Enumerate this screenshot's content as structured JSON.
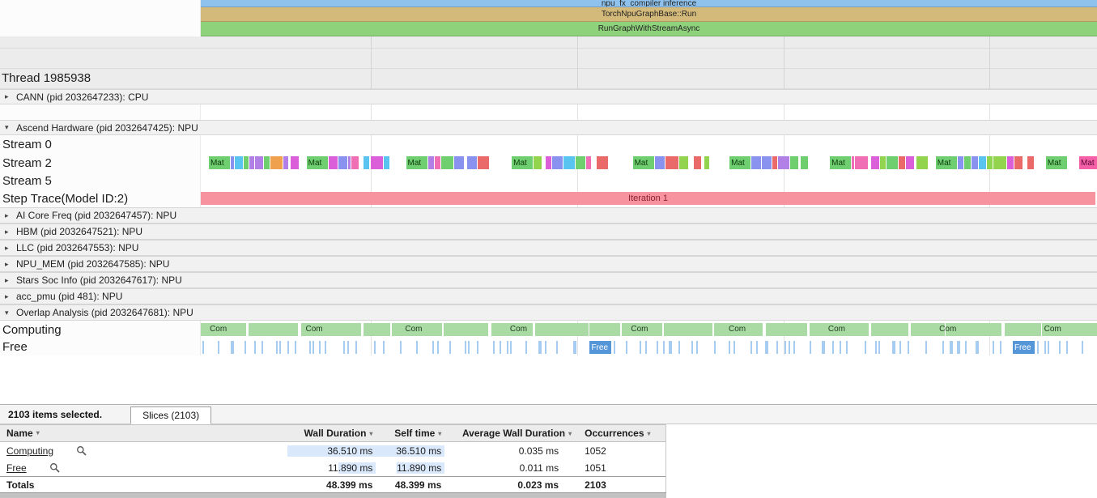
{
  "layout": {
    "grid_pct": [
      19,
      42,
      65,
      88
    ]
  },
  "top_bars": [
    {
      "label": "npu_fx_compiler inference",
      "color": "#8fc3ee"
    },
    {
      "label": "TorchNpuGraphBase::Run",
      "color": "#d4ba7a"
    },
    {
      "label": "RunGraphWithStreamAsync",
      "color": "#8fd27c"
    }
  ],
  "thread_label": "Thread 1985938",
  "headers": {
    "cann": {
      "arrow": "▸",
      "label": "CANN (pid 2032647233): CPU"
    },
    "ascend": {
      "arrow": "▾",
      "label": "Ascend Hardware (pid 2032647425): NPU"
    },
    "collapsed": [
      {
        "arrow": "▸",
        "label": "AI Core Freq (pid 2032647457): NPU"
      },
      {
        "arrow": "▸",
        "label": "HBM (pid 2032647521): NPU"
      },
      {
        "arrow": "▸",
        "label": "LLC (pid 2032647553): NPU"
      },
      {
        "arrow": "▸",
        "label": "NPU_MEM (pid 2032647585): NPU"
      },
      {
        "arrow": "▸",
        "label": "Stars Soc Info (pid 2032647617): NPU"
      },
      {
        "arrow": "▸",
        "label": "acc_pmu (pid 481): NPU"
      },
      {
        "arrow": "▾",
        "label": "Overlap Analysis (pid 2032647681): NPU"
      }
    ]
  },
  "tracks": {
    "stream0": {
      "label": "Stream 0"
    },
    "stream2": {
      "label": "Stream 2",
      "slice_label": "Mat",
      "mat_color": "#6fce6f",
      "mat_positions_pct": [
        0.9,
        11.8,
        22.9,
        34.7,
        48.2,
        59.0,
        70.2,
        82.0,
        94.3
      ],
      "noise_colors": [
        "#f06eb4",
        "#b27fe6",
        "#f0a14e",
        "#59c4f0",
        "#6fcf6f",
        "#ea6a6a",
        "#da5fd8",
        "#93d44f",
        "#8a92ef"
      ],
      "end_slice": {
        "label": "Mat",
        "color": "#f45fa8"
      }
    },
    "stream5": {
      "label": "Stream 5"
    },
    "step_trace": {
      "label": "Step Trace(Model ID:2)",
      "bar_label": "Iteration 1",
      "bar_color": "#f7939e",
      "bar_text_color": "#8c2430"
    },
    "computing": {
      "label": "Computing",
      "slice_label": "Com",
      "color": "#abdba4",
      "label_positions_pct": [
        1.0,
        11.7,
        22.8,
        34.5,
        48.0,
        58.9,
        70.0,
        82.4,
        94.1
      ]
    },
    "free": {
      "label": "Free",
      "slice_label": "Free",
      "bar_color": "#a6ccf1",
      "box_color": "#5596d8",
      "label_positions_pct": [
        43.4,
        90.6
      ]
    }
  },
  "bottom_panel": {
    "selected_text": "2103 items selected.",
    "tab_label": "Slices (2103)",
    "table": {
      "col_name": "Name",
      "col_wall": "Wall Duration",
      "col_self": "Self time",
      "col_avg": "Average Wall Duration",
      "col_occ": "Occurrences",
      "filter_icon": "▾",
      "fill_color": "#d9e8fb",
      "rows": [
        {
          "name": "Computing",
          "wall": "36.510 ms",
          "self": "36.510 ms",
          "avg": "0.035 ms",
          "occ": "1052",
          "wall_fill_pct": 100,
          "self_fill_pct": 100
        },
        {
          "name": "Free",
          "wall": "11.890 ms",
          "self": "11.890 ms",
          "avg": "0.011 ms",
          "occ": "1051",
          "wall_fill_pct": 42,
          "self_fill_pct": 70
        }
      ],
      "totals": {
        "name": "Totals",
        "wall": "48.399 ms",
        "self": "48.399 ms",
        "avg": "0.023 ms",
        "occ": "2103"
      }
    }
  }
}
